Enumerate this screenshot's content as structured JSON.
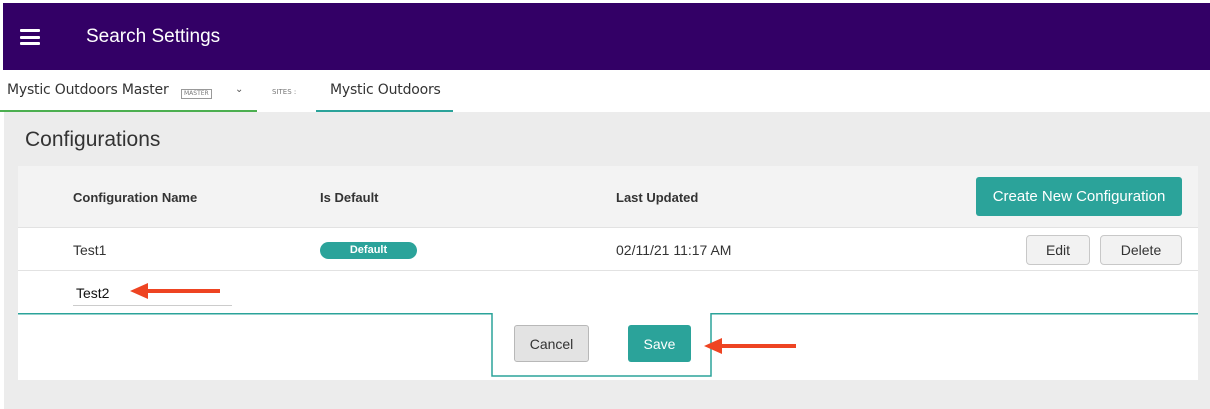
{
  "header": {
    "title": "Search Settings",
    "menu_icon": "hamburger-menu-icon",
    "background_color": "#330066"
  },
  "site_bar": {
    "master_name": "Mystic Outdoors Master",
    "master_badge": "MASTER",
    "dropdown_icon": "chevron-down-icon",
    "sites_label": "SITES :",
    "site_tab": "Mystic Outdoors"
  },
  "page": {
    "title": "Configurations"
  },
  "table": {
    "columns": [
      "Configuration Name",
      "Is Default",
      "Last Updated"
    ],
    "create_button": "Create New Configuration",
    "rows": [
      {
        "name": "Test1",
        "is_default_badge": "Default",
        "last_updated": "02/11/21 11:17 AM",
        "edit_label": "Edit",
        "delete_label": "Delete"
      }
    ],
    "new_row": {
      "name_value": "Test2"
    }
  },
  "actions": {
    "cancel_label": "Cancel",
    "save_label": "Save"
  },
  "colors": {
    "accent": "#2ba39a",
    "header_bg": "#330066",
    "annotation_arrow": "#ee4422"
  }
}
